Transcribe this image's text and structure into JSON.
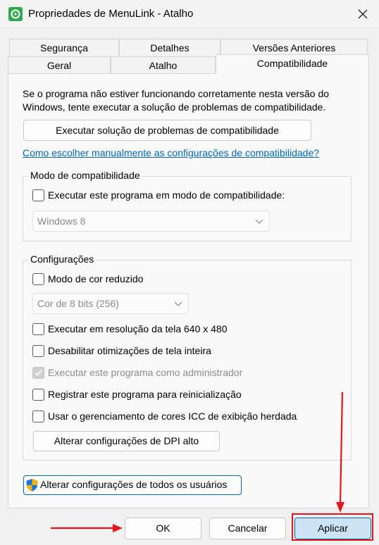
{
  "window": {
    "title": "Propriedades de MenuLink - Atalho"
  },
  "tabs": {
    "row1": [
      "Segurança",
      "Detalhes",
      "Versões Anteriores"
    ],
    "row2": [
      "Geral",
      "Atalho",
      "Compatibilidade"
    ],
    "active": "Compatibilidade"
  },
  "compat": {
    "intro_line1": "Se o programa não estiver funcionando corretamente nesta versão do",
    "intro_line2": "Windows, tente executar a solução de problemas de compatibilidade.",
    "troubleshoot_button": "Executar solução de problemas de compatibilidade",
    "manual_link": "Como escolher manualmente as configurações de compatibilidade?",
    "mode_group": {
      "title": "Modo de compatibilidade",
      "checkbox_label": "Executar este programa em modo de compatibilidade:",
      "checked": false,
      "os_select_value": "Windows 8"
    },
    "settings_group": {
      "title": "Configurações",
      "reduced_color_label": "Modo de cor reduzido",
      "reduced_color_checked": false,
      "color_select_value": "Cor de 8 bits (256)",
      "resolution_label": "Executar em resolução da tela 640 x 480",
      "fullscreen_label": "Desabilitar otimizações de tela inteira",
      "admin_label": "Executar este programa como administrador",
      "admin_checked": true,
      "restart_label": "Registrar este programa para reinicialização",
      "icc_label": "Usar o gerenciamento de cores ICC de exibição herdada",
      "dpi_button": "Alterar configurações de DPI alto"
    },
    "all_users_button": "Alterar configurações de todos os usuários"
  },
  "footer": {
    "ok": "OK",
    "cancel": "Cancelar",
    "apply": "Aplicar"
  },
  "colors": {
    "accent": "#0067c0",
    "annotation_red": "#e8141c"
  }
}
